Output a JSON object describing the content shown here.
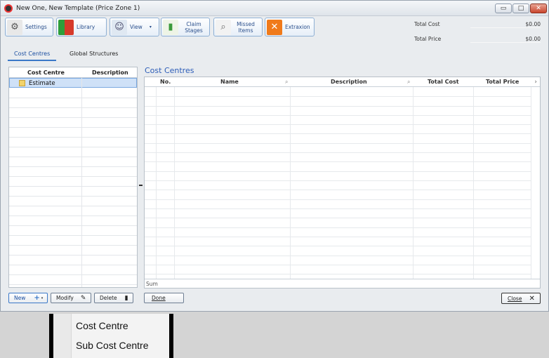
{
  "window": {
    "title": "New One, New Template (Price Zone 1)",
    "minimize": "▭",
    "maximize": "□",
    "close": "✕"
  },
  "toolbar": {
    "settings": "Settings",
    "library": "Library",
    "view": "View",
    "claim_stages": "Claim Stages",
    "missed_items": "Missed Items",
    "extraxion": "Extraxion"
  },
  "totals": {
    "total_cost_label": "Total Cost",
    "total_cost_value": "$0.00",
    "total_price_label": "Total Price",
    "total_price_value": "$0.00"
  },
  "tabs": [
    {
      "label": "Cost Centres",
      "active": true
    },
    {
      "label": "Global Structures",
      "active": false
    }
  ],
  "left_panel": {
    "col_cost_centre": "Cost Centre",
    "col_description": "Description",
    "rows": [
      {
        "name": "Estimate",
        "selected": true
      }
    ]
  },
  "right_panel": {
    "title": "Cost Centres",
    "columns": [
      "No.",
      "Name",
      "Description",
      "Total Cost",
      "Total Price"
    ],
    "sum_label": "Sum"
  },
  "buttons": {
    "new": "New",
    "modify": "Modify",
    "delete": "Delete",
    "done": "Done",
    "close": "Close"
  },
  "popup_menu": {
    "items": [
      "Cost Centre",
      "Sub Cost Centre"
    ]
  },
  "colors": {
    "accent": "#3a78c8",
    "title_blue": "#2d5db8",
    "selection": "#cfe1f7"
  }
}
